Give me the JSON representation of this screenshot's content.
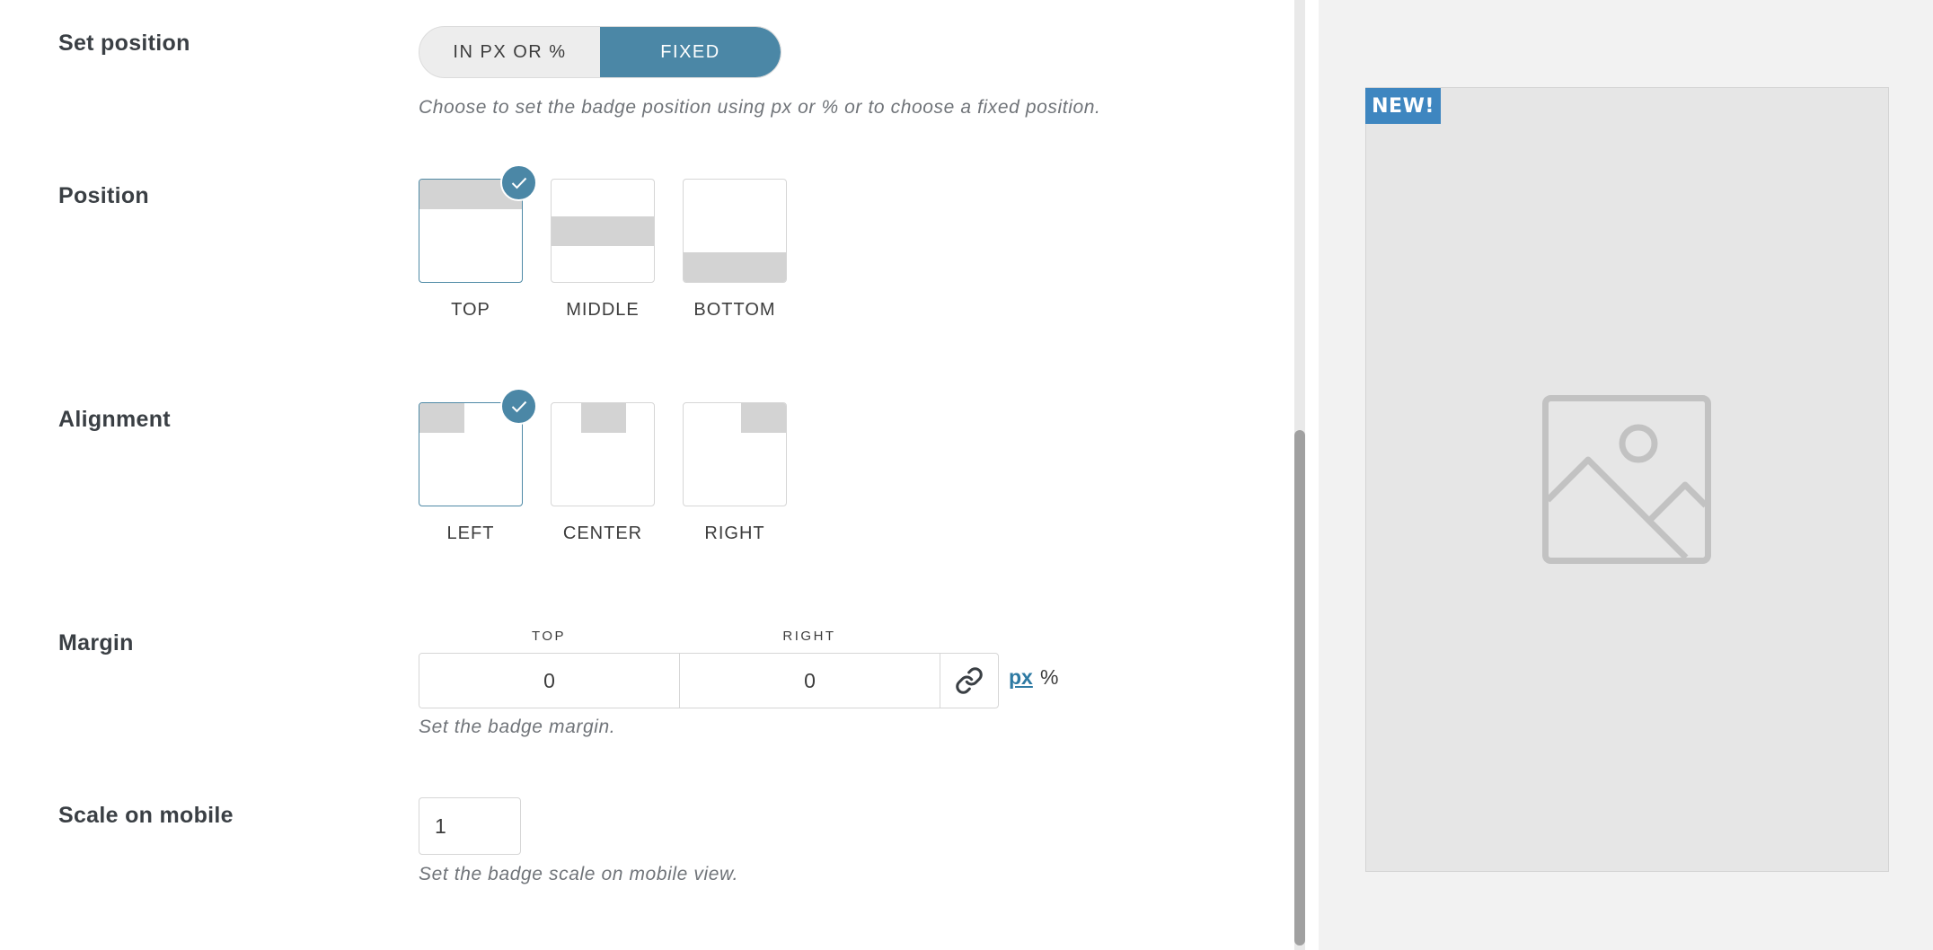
{
  "set_position": {
    "label": "Set position",
    "options": [
      "IN PX OR %",
      "FIXED"
    ],
    "selected": "FIXED",
    "description": "Choose to set the badge position using px or % or to choose a fixed position."
  },
  "position": {
    "label": "Position",
    "options": [
      "TOP",
      "MIDDLE",
      "BOTTOM"
    ],
    "selected": "TOP"
  },
  "alignment": {
    "label": "Alignment",
    "options": [
      "LEFT",
      "CENTER",
      "RIGHT"
    ],
    "selected": "LEFT"
  },
  "margin": {
    "label": "Margin",
    "fields": [
      {
        "label": "TOP",
        "value": "0"
      },
      {
        "label": "RIGHT",
        "value": "0"
      }
    ],
    "units": [
      "px",
      "%"
    ],
    "selected_unit": "px",
    "description": "Set the badge margin."
  },
  "scale_on_mobile": {
    "label": "Scale on mobile",
    "value": "1",
    "description": "Set the badge scale on mobile view."
  },
  "preview": {
    "badge_text": "NEW!"
  },
  "colors": {
    "accent": "#4b87a6",
    "badge": "#3e86c0",
    "link": "#2e7aa3"
  }
}
